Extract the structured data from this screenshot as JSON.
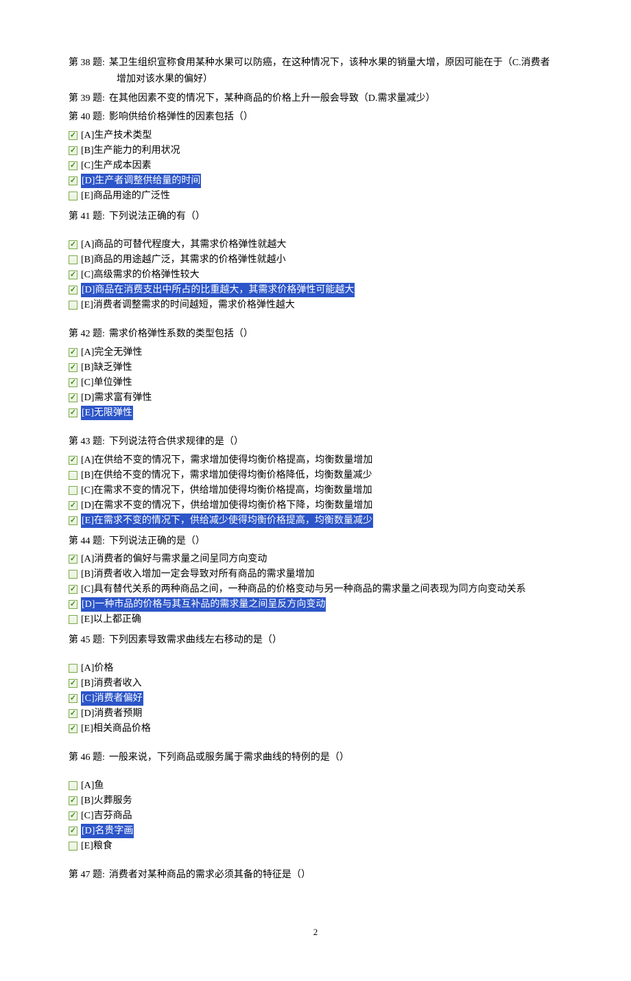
{
  "q38": {
    "num": "第 38 题:",
    "line1": "某卫生组织宣称食用某种水果可以防癌，在这种情况下，该种水果的销量大增，原因可能在于（C.消费者",
    "line2": "增加对该水果的偏好）"
  },
  "q39": {
    "num": "第 39 题:",
    "text": "在其他因素不变的情况下，某种商品的价格上升一般会导致（D.需求量减少）"
  },
  "q40": {
    "num": "第 40 题:",
    "text": "影响供给价格弹性的因素包括（）",
    "opts": [
      {
        "checked": true,
        "label": "[A]生产技术类型",
        "hl": false
      },
      {
        "checked": true,
        "label": "[B]生产能力的利用状况",
        "hl": false
      },
      {
        "checked": true,
        "label": "[C]生产成本因素",
        "hl": false
      },
      {
        "checked": true,
        "label": "[D]生产者调整供给量的时间",
        "hl": true
      },
      {
        "checked": false,
        "label": "[E]商品用途的广泛性",
        "hl": false
      }
    ]
  },
  "q41": {
    "num": "第 41 题:",
    "text": "下列说法正确的有（）",
    "opts": [
      {
        "checked": true,
        "label": "[A]商品的可替代程度大，其需求价格弹性就越大",
        "hl": false
      },
      {
        "checked": false,
        "label": "[B]商品的用途越广泛，其需求的价格弹性就越小",
        "hl": false
      },
      {
        "checked": true,
        "label": "[C]高级需求的价格弹性较大",
        "hl": false
      },
      {
        "checked": true,
        "label": "[D]商品在消费支出中所占的比重越大，其需求价格弹性可能越大",
        "hl": true
      },
      {
        "checked": false,
        "label": "[E]消费者调整需求的时间越短，需求价格弹性越大",
        "hl": false
      }
    ]
  },
  "q42": {
    "num": "第 42 题:",
    "text": "需求价格弹性系数的类型包括（）",
    "opts": [
      {
        "checked": true,
        "label": "[A]完全无弹性",
        "hl": false
      },
      {
        "checked": true,
        "label": "[B]缺乏弹性",
        "hl": false
      },
      {
        "checked": true,
        "label": "[C]单位弹性",
        "hl": false
      },
      {
        "checked": true,
        "label": "[D]需求富有弹性",
        "hl": false
      },
      {
        "checked": true,
        "label": "[E]无限弹性",
        "hl": true
      }
    ]
  },
  "q43": {
    "num": "第 43 题:",
    "text": "下列说法符合供求规律的是（）",
    "opts": [
      {
        "checked": true,
        "label": "[A]在供给不变的情况下，需求增加使得均衡价格提高，均衡数量增加",
        "hl": false
      },
      {
        "checked": false,
        "label": "[B]在供给不变的情况下，需求增加使得均衡价格降低，均衡数量减少",
        "hl": false
      },
      {
        "checked": false,
        "label": "[C]在需求不变的情况下，供给增加使得均衡价格提高，均衡数量增加",
        "hl": false
      },
      {
        "checked": true,
        "label": "[D]在需求不变的情况下，供给增加使得均衡价格下降，均衡数量增加",
        "hl": false
      },
      {
        "checked": true,
        "label": "[E]在需求不变的情况下，供给减少使得均衡价格提高，均衡数量减少",
        "hl": true
      }
    ]
  },
  "q44": {
    "num": "第 44 题:",
    "text": "下列说法正确的是（）",
    "opts": [
      {
        "checked": true,
        "label": "[A]消费者的偏好与需求量之间呈同方向变动",
        "hl": false
      },
      {
        "checked": false,
        "label": "[B]消费者收入增加一定会导致对所有商品的需求量增加",
        "hl": false
      },
      {
        "checked": true,
        "label": "[C]具有替代关系的两种商品之间，一种商品的价格变动与另一种商品的需求量之间表现为同方向变动关系",
        "hl": false
      },
      {
        "checked": true,
        "label": "[D]一种市品的价格与其互补品的需求量之间呈反方向变动",
        "hl": true
      },
      {
        "checked": false,
        "label": "[E]以上都正确",
        "hl": false
      }
    ]
  },
  "q45": {
    "num": "第 45 题:",
    "text": "下列因素导致需求曲线左右移动的是（）",
    "opts": [
      {
        "checked": false,
        "label": "[A]价格",
        "hl": false
      },
      {
        "checked": true,
        "label": "[B]消费者收入",
        "hl": false
      },
      {
        "checked": true,
        "label": "[C]消费者偏好",
        "hl": true
      },
      {
        "checked": true,
        "label": "[D]消费者预期",
        "hl": false
      },
      {
        "checked": true,
        "label": "[E]相关商品价格",
        "hl": false
      }
    ]
  },
  "q46": {
    "num": "第 46 题:",
    "text": "一般来说，下列商品或服务属于需求曲线的特例的是（）",
    "opts": [
      {
        "checked": false,
        "label": "[A]鱼",
        "hl": false
      },
      {
        "checked": true,
        "label": "[B]火葬服务",
        "hl": false
      },
      {
        "checked": true,
        "label": "[C]吉芬商品",
        "hl": false
      },
      {
        "checked": true,
        "label": "[D]名贵字画",
        "hl": true
      },
      {
        "checked": false,
        "label": "[E]粮食",
        "hl": false
      }
    ]
  },
  "q47": {
    "num": "第 47 题:",
    "text": "消费者对某种商品的需求必须其备的特征是（）"
  },
  "page_num": "2"
}
